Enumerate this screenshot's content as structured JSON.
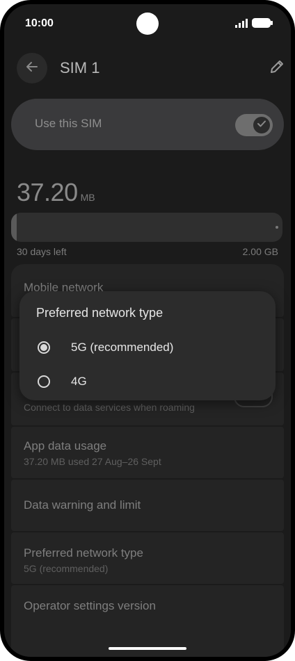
{
  "status_bar": {
    "time": "10:00"
  },
  "header": {
    "title": "SIM 1"
  },
  "sim_toggle": {
    "label": "Use this SIM",
    "enabled": true
  },
  "usage": {
    "amount": "37.20",
    "unit": "MB",
    "days_left": "30 days left",
    "limit": "2.00 GB",
    "fill_fraction": 0.02
  },
  "list": {
    "mobile_network": {
      "title": "Mobile network"
    },
    "roaming": {
      "subtitle": "Connect to data services when roaming"
    },
    "app_data_usage": {
      "title": "App data usage",
      "subtitle": "37.20 MB used 27 Aug–26 Sept"
    },
    "data_warning": {
      "title": "Data warning and limit"
    },
    "preferred_network": {
      "title": "Preferred network type",
      "subtitle": "5G (recommended)"
    },
    "operator_settings": {
      "title": "Operator settings version"
    }
  },
  "dialog": {
    "title": "Preferred network type",
    "options": [
      {
        "label": "5G (recommended)",
        "selected": true
      },
      {
        "label": "4G",
        "selected": false
      }
    ]
  },
  "icons": [
    "back-arrow-icon",
    "edit-pencil-icon",
    "signal-icon",
    "battery-icon",
    "check-icon"
  ]
}
